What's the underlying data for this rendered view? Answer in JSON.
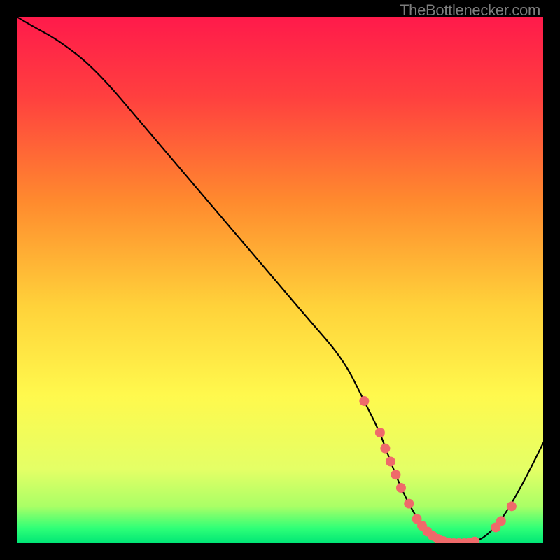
{
  "attribution": "TheBottlenecker.com",
  "chart_data": {
    "type": "line",
    "title": "",
    "xlabel": "",
    "ylabel": "",
    "xlim": [
      0,
      100
    ],
    "ylim": [
      0,
      100
    ],
    "background_gradient": {
      "stops": [
        {
          "offset": 0.0,
          "color": "#ff1a4b"
        },
        {
          "offset": 0.15,
          "color": "#ff3f3f"
        },
        {
          "offset": 0.35,
          "color": "#ff8a2e"
        },
        {
          "offset": 0.55,
          "color": "#ffd23a"
        },
        {
          "offset": 0.72,
          "color": "#fff94d"
        },
        {
          "offset": 0.86,
          "color": "#e4ff66"
        },
        {
          "offset": 0.93,
          "color": "#aaff66"
        },
        {
          "offset": 0.972,
          "color": "#2eff77"
        },
        {
          "offset": 1.0,
          "color": "#00e676"
        }
      ]
    },
    "series": [
      {
        "name": "bottleneck-curve",
        "color": "#000000",
        "x": [
          0,
          3,
          8,
          15,
          25,
          35,
          45,
          55,
          62,
          66,
          69,
          71,
          73,
          75,
          77,
          79,
          81,
          83,
          85,
          87,
          89,
          92,
          96,
          100
        ],
        "y": [
          100,
          98.2,
          95.5,
          90,
          78.3,
          66.5,
          54.8,
          43,
          35,
          27,
          21,
          15.5,
          10.5,
          6.5,
          3.3,
          1.4,
          0.4,
          0,
          0,
          0.3,
          1.2,
          4.2,
          11,
          19
        ]
      }
    ],
    "points": {
      "name": "in-range-markers",
      "color": "#ef6a6a",
      "radius_px": 7,
      "data": [
        {
          "x": 66,
          "y": 27
        },
        {
          "x": 69,
          "y": 21
        },
        {
          "x": 70,
          "y": 18
        },
        {
          "x": 71,
          "y": 15.5
        },
        {
          "x": 72,
          "y": 13
        },
        {
          "x": 73,
          "y": 10.5
        },
        {
          "x": 74.5,
          "y": 7.5
        },
        {
          "x": 76,
          "y": 4.6
        },
        {
          "x": 77,
          "y": 3.3
        },
        {
          "x": 78,
          "y": 2.2
        },
        {
          "x": 79,
          "y": 1.4
        },
        {
          "x": 80,
          "y": 0.8
        },
        {
          "x": 81,
          "y": 0.4
        },
        {
          "x": 82,
          "y": 0.15
        },
        {
          "x": 83,
          "y": 0
        },
        {
          "x": 84,
          "y": 0
        },
        {
          "x": 85,
          "y": 0
        },
        {
          "x": 86,
          "y": 0.1
        },
        {
          "x": 87,
          "y": 0.3
        },
        {
          "x": 91,
          "y": 3
        },
        {
          "x": 92,
          "y": 4.2
        },
        {
          "x": 94,
          "y": 7
        }
      ]
    }
  }
}
